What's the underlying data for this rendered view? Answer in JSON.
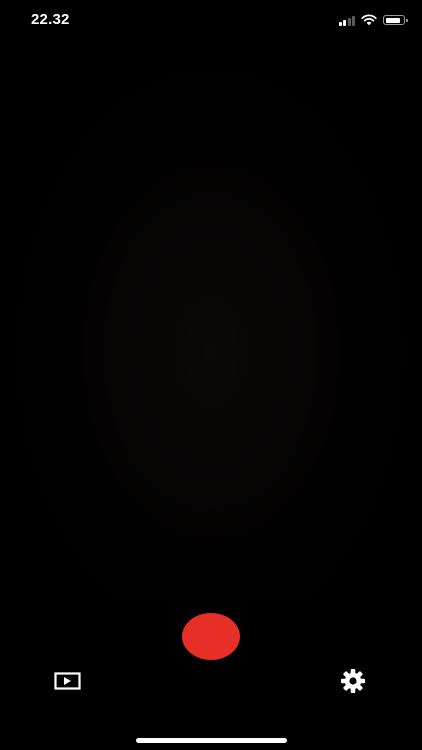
{
  "status_bar": {
    "time": "22.32",
    "signal_bars_active": 2,
    "signal_bars_total": 4,
    "battery_level": 0.85,
    "icons": [
      "cellular-signal-icon",
      "wifi-icon",
      "battery-icon"
    ]
  },
  "controls": {
    "record_color": "#e63027",
    "icons": {
      "gallery": "play-rectangle-icon",
      "settings": "gear-icon",
      "record": "record-dot-icon"
    }
  },
  "colors": {
    "background": "#000000",
    "foreground": "#ffffff"
  }
}
